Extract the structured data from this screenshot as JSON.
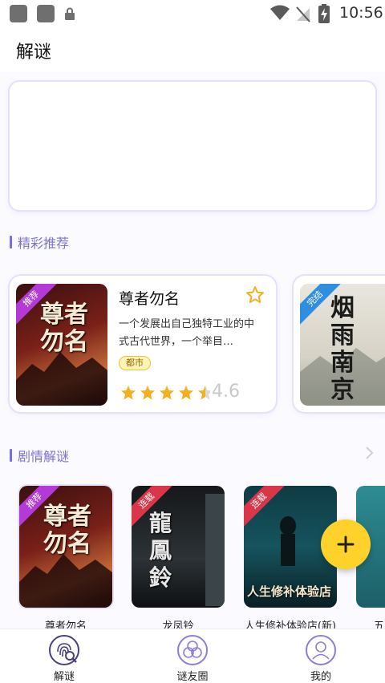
{
  "status_bar": {
    "time": "10:56"
  },
  "header": {
    "title": "解谜"
  },
  "sections": {
    "featured_title": "精彩推荐",
    "story_title": "剧情解谜"
  },
  "featured": [
    {
      "title": "尊者勿名",
      "cover_text": "尊者勿名",
      "ribbon": "推荐",
      "description": "一个发展出自己独特工业的中式古代世界，一个举目…",
      "tag": "都市",
      "rating": "4.6",
      "stars": 4.5
    },
    {
      "cover_text": "烟雨南京",
      "ribbon": "完结"
    }
  ],
  "books": [
    {
      "title": "尊者勿名",
      "ribbon": "推荐",
      "cover_text": "尊者勿名"
    },
    {
      "title": "龙凤铃",
      "ribbon": "连载",
      "cover_text": "龍鳳鈴"
    },
    {
      "title": "人生修补体验店(新)",
      "ribbon": "连载",
      "cover_text": "人生修补体验店"
    },
    {
      "title": "五"
    }
  ],
  "bottom_nav": [
    {
      "label": "解谜",
      "icon": "fingerprint-search-icon",
      "active": true
    },
    {
      "label": "谜友圈",
      "icon": "circles-icon",
      "active": false
    },
    {
      "label": "我的",
      "icon": "user-icon",
      "active": false
    }
  ],
  "colors": {
    "accent": "#7b73d6",
    "fab": "#ffd12b",
    "star": "#f2b01e",
    "ribbon_recommend": "#b33ad6",
    "ribbon_serial": "#d9364a",
    "ribbon_complete": "#2f8ee0"
  }
}
